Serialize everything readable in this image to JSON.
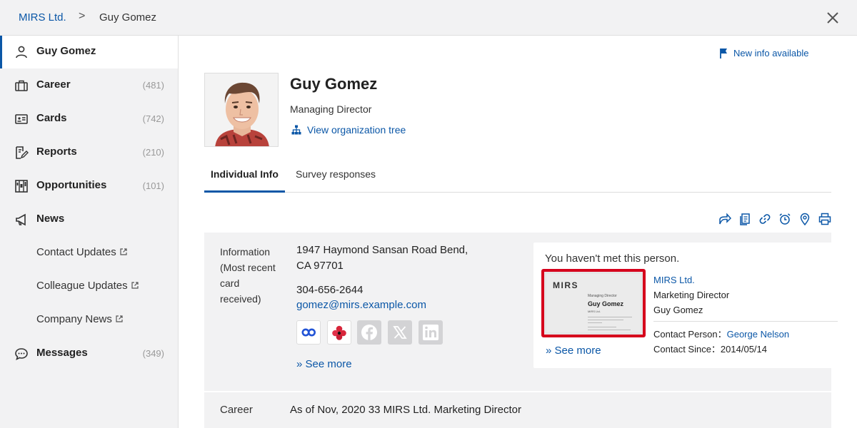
{
  "breadcrumb": {
    "company": "MIRS Ltd.",
    "separator": ">",
    "person": "Guy Gomez"
  },
  "sidebar": {
    "items": [
      {
        "label": "Guy Gomez",
        "count": ""
      },
      {
        "label": "Career",
        "count": "(481)"
      },
      {
        "label": "Cards",
        "count": "(742)"
      },
      {
        "label": "Reports",
        "count": "(210)"
      },
      {
        "label": "Opportunities",
        "count": "(101)"
      },
      {
        "label": "News",
        "count": ""
      }
    ],
    "news_sub": [
      "Contact Updates",
      "Colleague Updates",
      "Company News"
    ],
    "messages": {
      "label": "Messages",
      "count": "(349)"
    }
  },
  "header": {
    "new_info": "New info available"
  },
  "profile": {
    "name": "Guy Gomez",
    "title": "Managing Director",
    "org_link": "View organization tree"
  },
  "tabs": [
    "Individual Info",
    "Survey responses"
  ],
  "info": {
    "label_line1": "Information",
    "label_line2": "(Most recent",
    "label_line3": "card",
    "label_line4": "received)",
    "address_line1": "1947 Haymond Sansan Road Bend,",
    "address_line2": "CA 97701",
    "phone": "304-656-2644",
    "email": "gomez@mirs.example.com",
    "social_icons": [
      "teams-icon",
      "flower-app-icon",
      "facebook-icon",
      "x-icon",
      "linkedin-icon"
    ],
    "see_more": "» See more"
  },
  "card": {
    "met_message": "You haven't met this person.",
    "thumb": {
      "logo": "MIRS",
      "role": "Managing Director",
      "name": "Guy Gomez",
      "company": "MIRS Ltd."
    },
    "see_more": "» See more",
    "company": "MIRS Ltd.",
    "role": "Marketing Director",
    "person": "Guy Gomez",
    "contact_person_label": "Contact Person：",
    "contact_person": "George Nelson",
    "contact_since": "Contact Since：2014/05/14"
  },
  "career": {
    "label": "Career",
    "value": "As of Nov, 2020 33 MIRS Ltd. Marketing Director"
  },
  "colors": {
    "accent": "#0b57a7",
    "card_border": "#d6001c",
    "panel_bg": "#f2f2f3"
  }
}
